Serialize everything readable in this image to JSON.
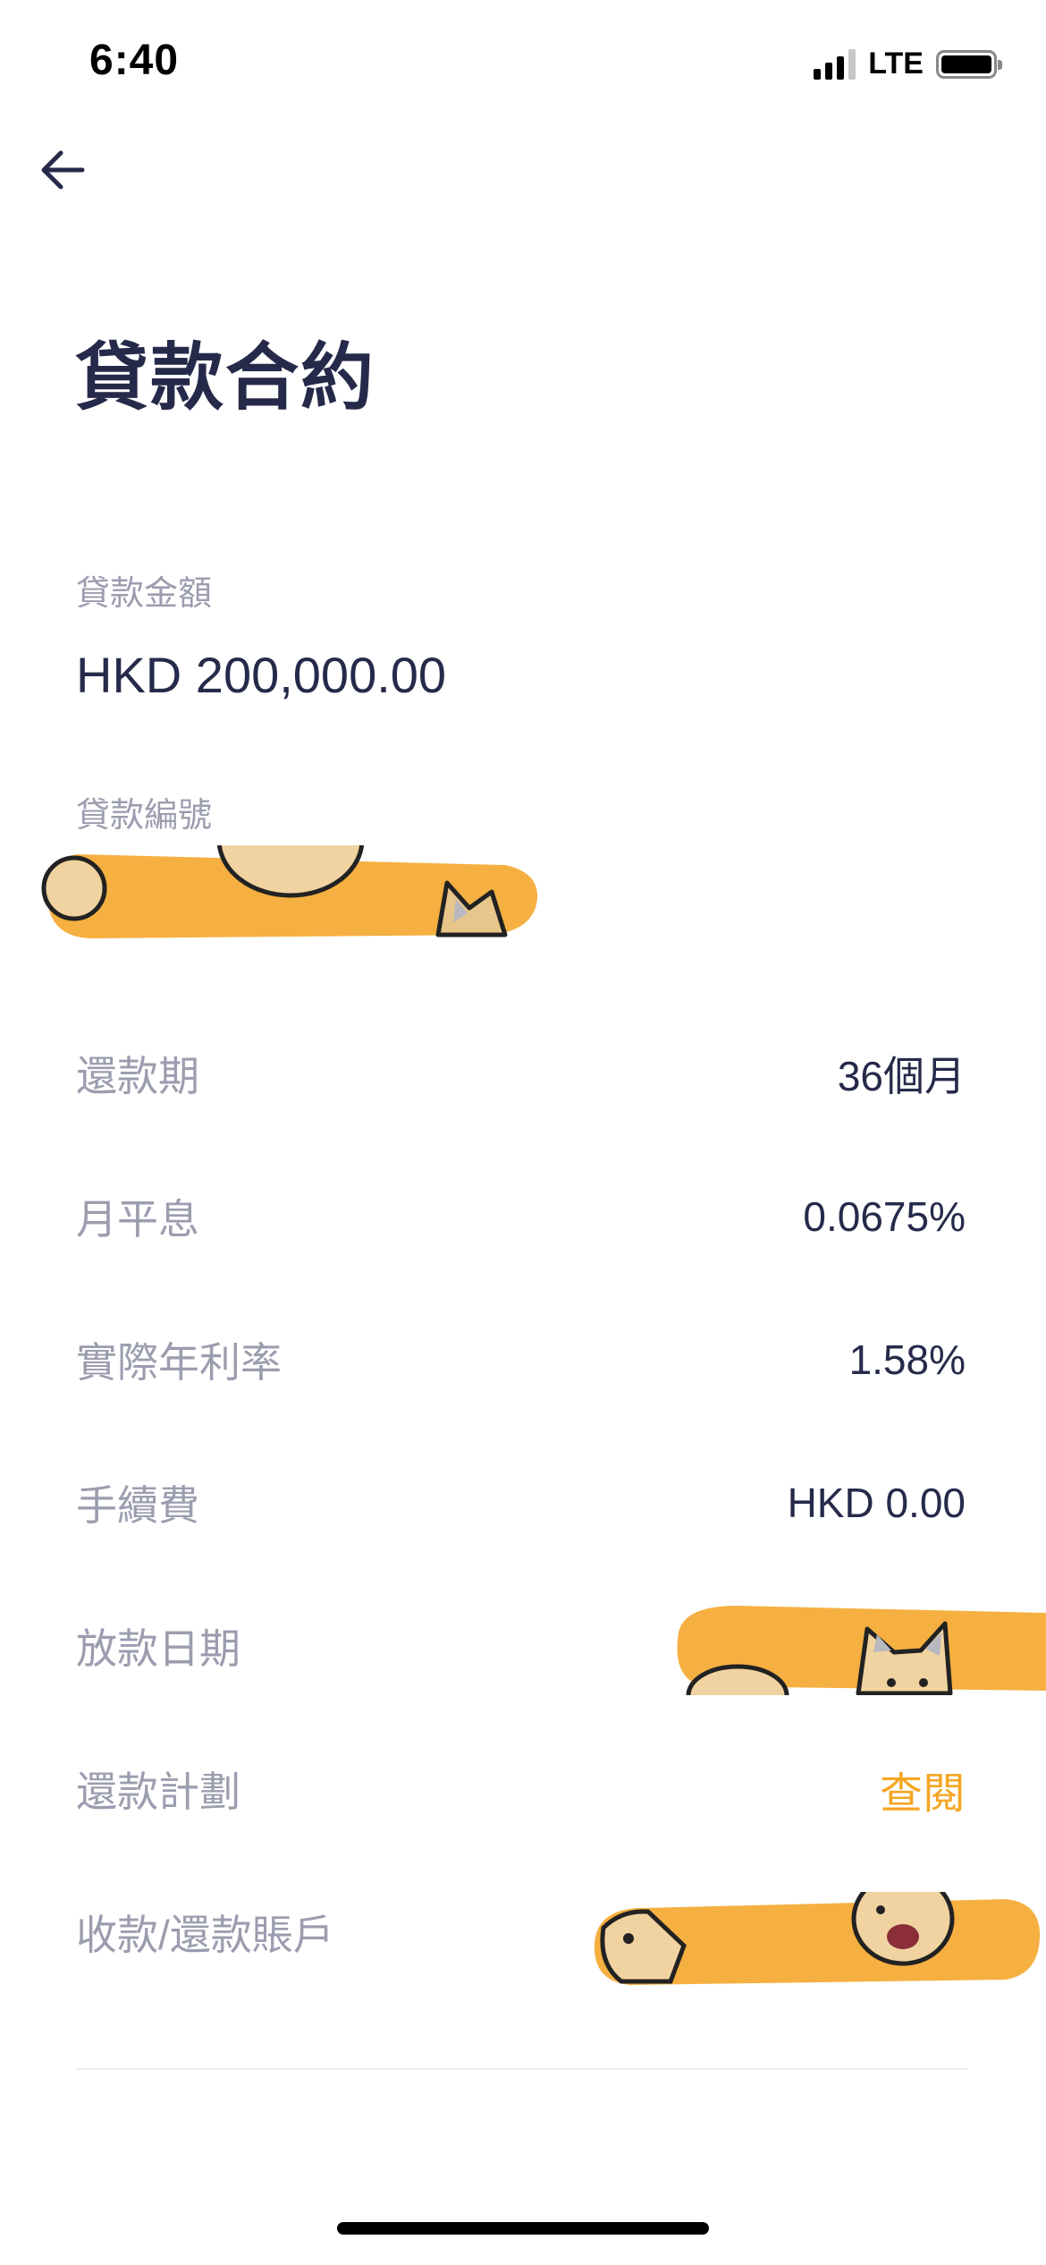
{
  "status_bar": {
    "time": "6:40",
    "network": "LTE"
  },
  "header": {
    "back_icon": "arrow-left-icon",
    "title": "貸款合約"
  },
  "loan_amount": {
    "label": "貸款金額",
    "value": "HKD 200,000.00"
  },
  "loan_number": {
    "label": "貸款編號"
  },
  "details": {
    "repayment_period": {
      "label": "還款期",
      "value": "36個月"
    },
    "monthly_flat_rate": {
      "label": "月平息",
      "value": "0.0675%"
    },
    "apr": {
      "label": "實際年利率",
      "value": "1.58%"
    },
    "handling_fee": {
      "label": "手續費",
      "value": "HKD 0.00"
    },
    "drawdown_date": {
      "label": "放款日期"
    },
    "repayment_schedule": {
      "label": "還款計劃",
      "link": "查閱"
    },
    "account": {
      "label": "收款/還款賬戶"
    }
  },
  "colors": {
    "title": "#262a4a",
    "label": "#9b9daf",
    "accent": "#f5a623",
    "redaction": "#f5b041"
  }
}
